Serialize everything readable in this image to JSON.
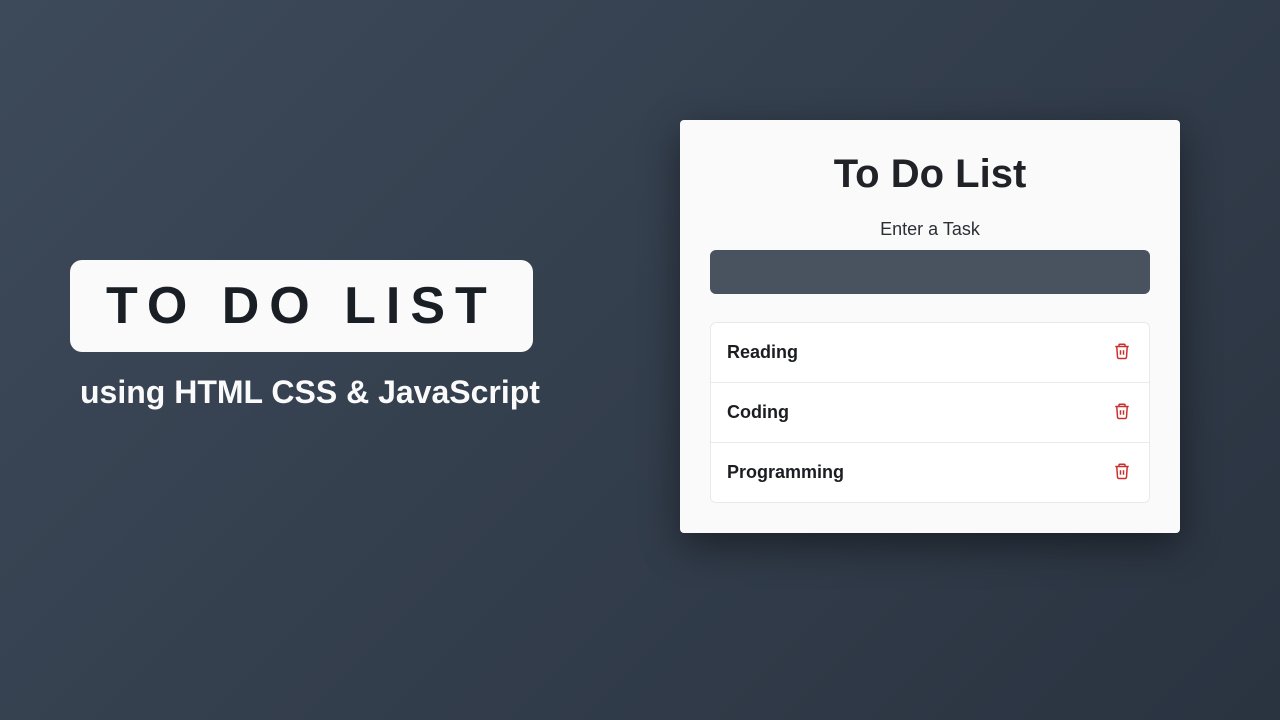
{
  "banner": {
    "title": "TO DO LIST",
    "subtitle": "using HTML CSS & JavaScript"
  },
  "todo": {
    "heading": "To Do List",
    "input_label": "Enter a Task",
    "input_value": "",
    "tasks": [
      {
        "label": "Reading"
      },
      {
        "label": "Coding"
      },
      {
        "label": "Programming"
      }
    ]
  }
}
